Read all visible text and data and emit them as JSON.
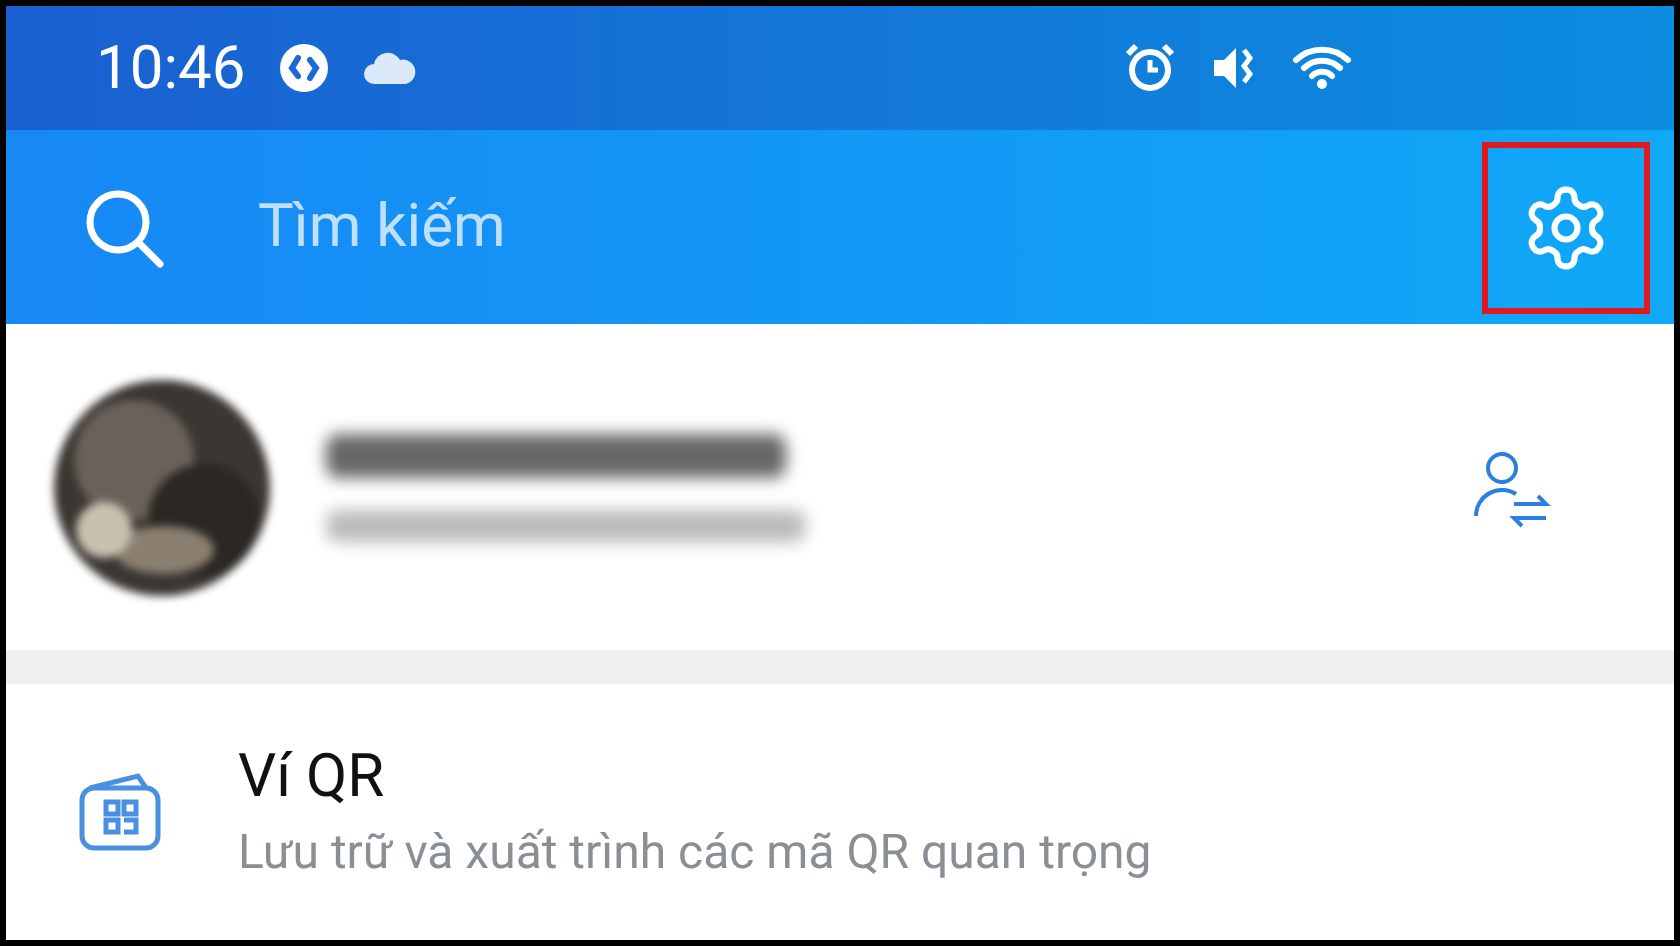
{
  "status_bar": {
    "time": "10:46"
  },
  "search": {
    "placeholder": "Tìm kiếm",
    "settings_highlighted": true
  },
  "menu": [
    {
      "title": "Ví QR",
      "subtitle": "Lưu trữ và xuất trình các mã QR quan trọng"
    }
  ]
}
